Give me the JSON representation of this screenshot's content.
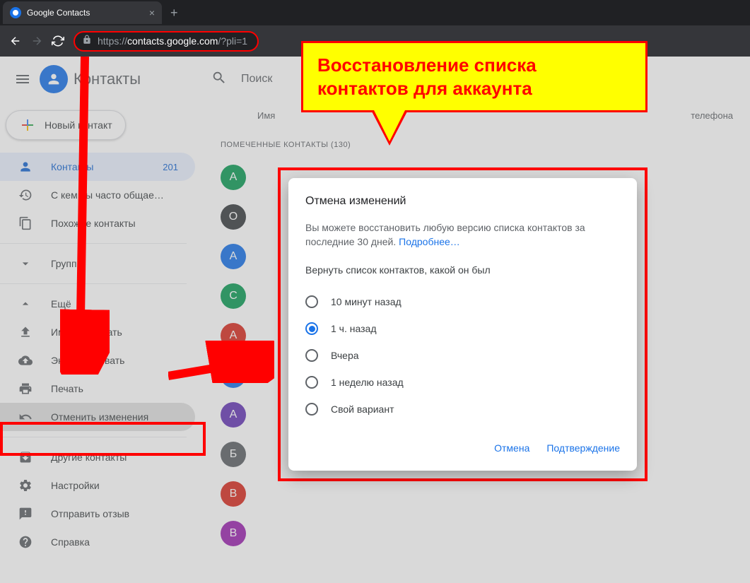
{
  "browser": {
    "tab_title": "Google Contacts",
    "url_protocol": "https://",
    "url_host": "contacts.google.com",
    "url_path": "/?pli=1"
  },
  "app": {
    "title": "Контакты",
    "search_placeholder": "Поиск",
    "create_label": "Новый контакт"
  },
  "sidebar": {
    "items": [
      {
        "icon": "person",
        "label": "Контакты",
        "count": "201"
      },
      {
        "icon": "history",
        "label": "С кем вы часто общае…"
      },
      {
        "icon": "copy",
        "label": "Похожие контакты"
      }
    ],
    "groups_label": "Группы",
    "more_label": "Ещё",
    "more_items": [
      {
        "icon": "upload",
        "label": "Импортировать"
      },
      {
        "icon": "cloud",
        "label": "Экспортировать"
      },
      {
        "icon": "print",
        "label": "Печать"
      },
      {
        "icon": "undo",
        "label": "Отменить изменения"
      }
    ],
    "other_items": [
      {
        "icon": "archive",
        "label": "Другие контакты"
      },
      {
        "icon": "settings",
        "label": "Настройки"
      },
      {
        "icon": "feedback",
        "label": "Отправить отзыв"
      },
      {
        "icon": "help",
        "label": "Справка"
      }
    ]
  },
  "content": {
    "col_name": "Имя",
    "col_phone": "телефона",
    "section_label": "ПОМЕЧЕННЫЕ КОНТАКТЫ (130)",
    "avatars": [
      {
        "letter": "А",
        "color": "#0f9d58"
      },
      {
        "letter": "О",
        "color": "#3c4043"
      },
      {
        "letter": "А",
        "color": "#1a73e8"
      },
      {
        "letter": "С",
        "color": "#0f9d58"
      },
      {
        "letter": "A",
        "color": "#d93025"
      },
      {
        "letter": "Е",
        "color": "#1a73e8"
      },
      {
        "letter": "А",
        "color": "#673ab7"
      },
      {
        "letter": "Б",
        "color": "#5f6368"
      },
      {
        "letter": "В",
        "color": "#d93025"
      },
      {
        "letter": "В",
        "color": "#9c27b0"
      }
    ]
  },
  "dialog": {
    "title": "Отмена изменений",
    "text1": "Вы можете восстановить любую версию списка контактов за последние 30 дней. ",
    "link": "Подробнее…",
    "subtitle": "Вернуть список контактов, какой он был",
    "options": [
      {
        "label": "10 минут назад",
        "selected": false
      },
      {
        "label": "1 ч. назад",
        "selected": true
      },
      {
        "label": "Вчера",
        "selected": false
      },
      {
        "label": "1 неделю назад",
        "selected": false
      },
      {
        "label": "Свой вариант",
        "selected": false
      }
    ],
    "cancel": "Отмена",
    "confirm": "Подтверждение"
  },
  "callout": {
    "text": "Восстановление списка контактов для аккаунта"
  }
}
